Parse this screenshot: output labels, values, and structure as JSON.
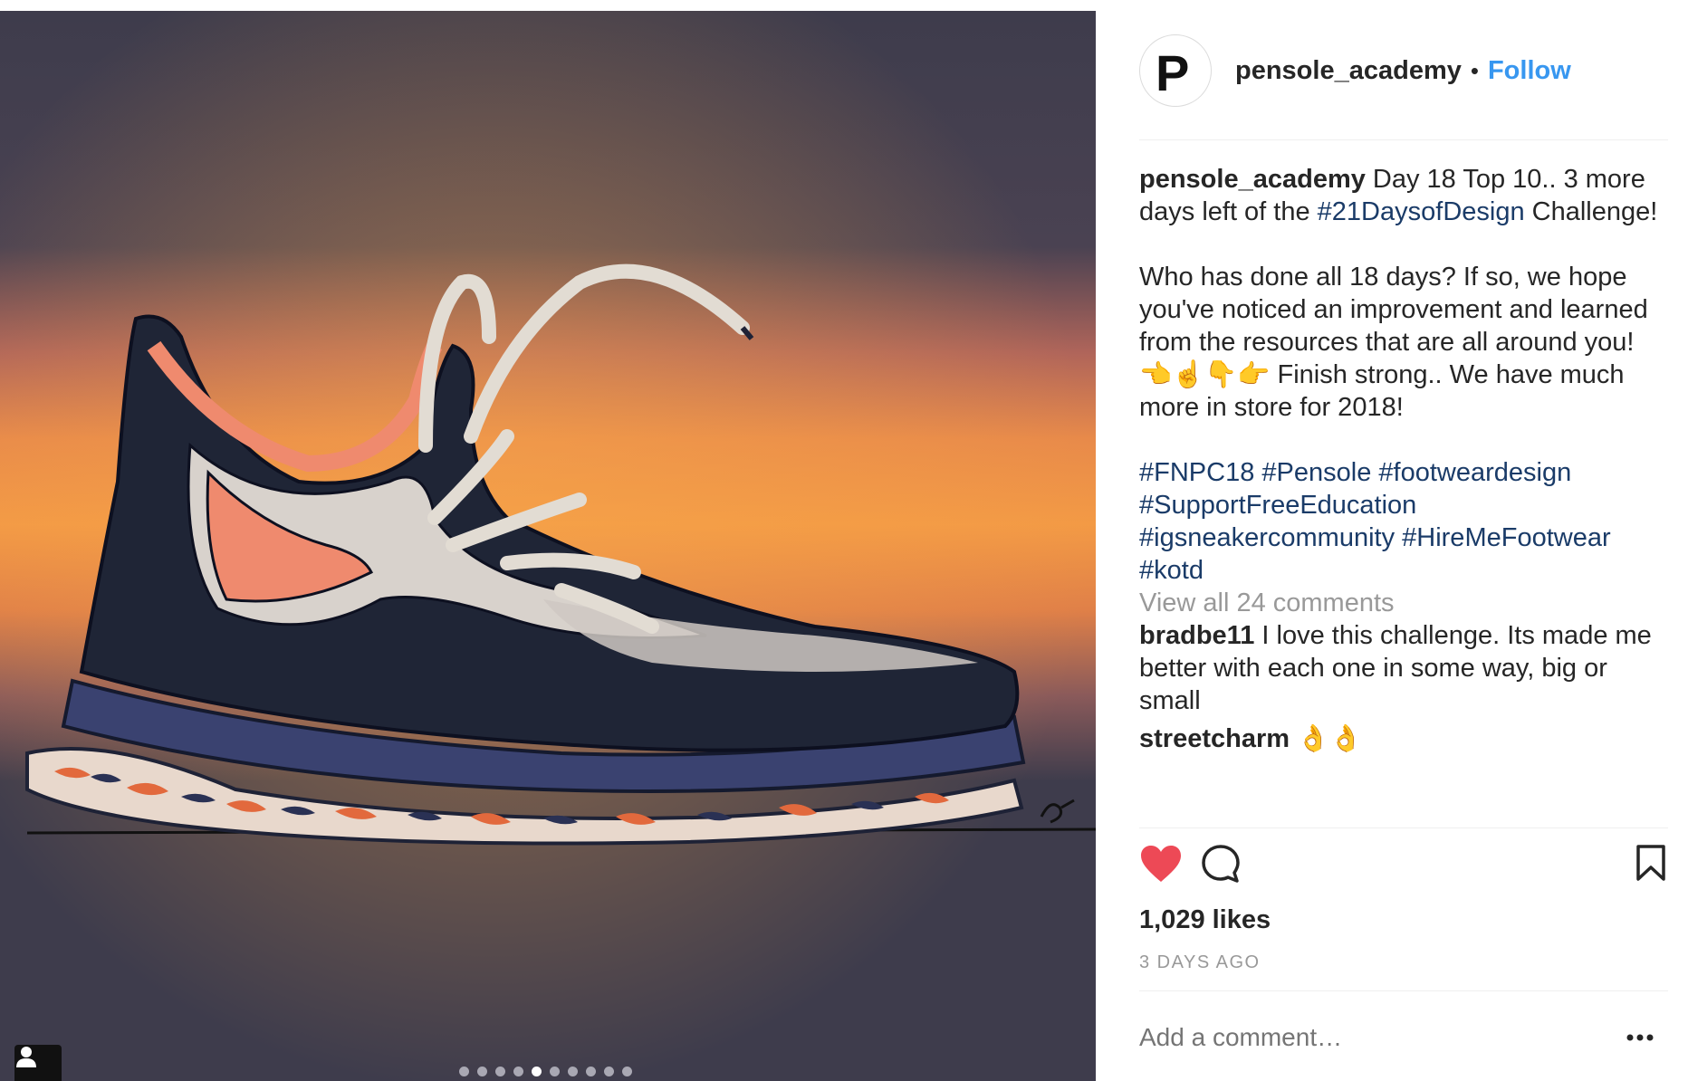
{
  "post": {
    "username": "pensole_academy",
    "separator": "•",
    "follow_label": "Follow",
    "avatar_letter": "P",
    "caption": {
      "text_1": "Day 18 Top 10.. 3 more days left of the ",
      "hashtag_1": "#21DaysofDesign",
      "text_2": " Challenge!",
      "paragraph_2": "Who has done all 18 days? If so, we hope you've noticed an improvement and learned from the resources that are all around you! 👈☝️👇👉 Finish strong.. We have much more in store for 2018!",
      "hashtags": [
        "#FNPC18",
        "#Pensole",
        "#footweardesign",
        "#SupportFreeEducation",
        "#igsneakercommunity",
        "#HireMeFootwear",
        "#kotd"
      ]
    },
    "view_all_comments": "View all 24 comments",
    "comments": [
      {
        "user": "bradbe11",
        "text": "I love this challenge. Its made me better with each one in some way, big or small"
      },
      {
        "user": "streetcharm",
        "text": "👌👌"
      }
    ],
    "likes": "1,029 likes",
    "time_ago": "3 DAYS AGO",
    "add_comment_placeholder": "Add a comment…",
    "carousel": {
      "count": 10,
      "active_index": 4
    }
  },
  "icons": {
    "like": "heart-icon",
    "comment": "comment-icon",
    "save": "bookmark-icon",
    "more": "more-icon",
    "tag": "user-tag-icon"
  },
  "colors": {
    "follow": "#3897f0",
    "hashtag": "#1a3b68",
    "like_active": "#ed4956",
    "photo_background": "#3e3c4c"
  }
}
